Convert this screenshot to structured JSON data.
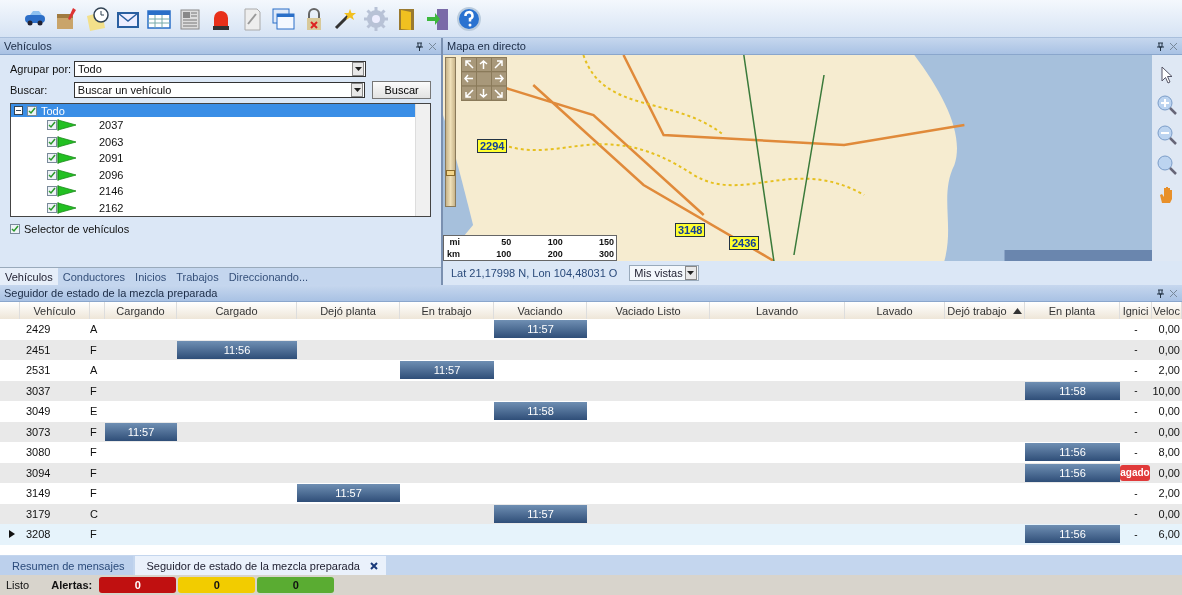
{
  "vehicles_panel": {
    "title": "Vehículos",
    "group_by": {
      "label": "Agrupar por:",
      "value": "Todo"
    },
    "search": {
      "label": "Buscar:",
      "value": "Buscar un vehículo",
      "button": "Buscar"
    },
    "tree": {
      "label": "Todo",
      "checked": true,
      "expanded": true,
      "selected": true,
      "children": [
        {
          "label": "2037",
          "checked": true
        },
        {
          "label": "2063",
          "checked": true
        },
        {
          "label": "2091",
          "checked": true
        },
        {
          "label": "2096",
          "checked": true
        },
        {
          "label": "2146",
          "checked": true
        },
        {
          "label": "2162",
          "checked": true
        }
      ]
    },
    "selector": {
      "label": "Selector de vehículos",
      "checked": true
    },
    "tabs": [
      {
        "label": "Vehículos",
        "selected": true
      },
      {
        "label": "Conductores",
        "selected": false
      },
      {
        "label": "Inicios",
        "selected": false
      },
      {
        "label": "Trabajos",
        "selected": false
      },
      {
        "label": "Direccionando...",
        "selected": false
      }
    ]
  },
  "map_panel": {
    "title": "Mapa en directo",
    "zoom": {
      "level": 0.2
    },
    "markers": [
      {
        "label": "2294"
      },
      {
        "label": "3148"
      },
      {
        "label": "2436"
      }
    ],
    "scale": {
      "mi_label": "mi",
      "km_label": "km",
      "mi_ticks": [
        "50",
        "100",
        "150"
      ],
      "km_ticks": [
        "100",
        "200",
        "300"
      ]
    },
    "coordinates": "Lat 21,17998 N, Lon 104,48031 O",
    "views_button": "Mis vistas"
  },
  "tracker_panel": {
    "title": "Seguidor de estado de la mezcla preparada",
    "columns": [
      {
        "label": "Vehículo",
        "sorted": false
      },
      {
        "sorted": false
      },
      {
        "label": "Cargando",
        "sorted": false
      },
      {
        "label": "Cargado",
        "sorted": false
      },
      {
        "label": "Dejó planta",
        "sorted": false
      },
      {
        "label": "En trabajo",
        "sorted": false
      },
      {
        "label": "Vaciando",
        "sorted": false
      },
      {
        "label": "Vaciado Listo",
        "sorted": false
      },
      {
        "label": "Lavando",
        "sorted": false
      },
      {
        "label": "Lavado",
        "sorted": false
      },
      {
        "label": "Dejó trabajo",
        "sorted": true
      },
      {
        "label": "En planta",
        "sorted": false
      },
      {
        "label": "Ignici",
        "sorted": false
      },
      {
        "label": "Veloc",
        "sorted": false
      }
    ],
    "rows": [
      {
        "vehicle": "2429",
        "column_2": "A",
        "stages": [
          {
            "filled": false
          },
          {
            "filled": false
          },
          {
            "filled": false
          },
          {
            "filled": false
          },
          {
            "filled": true,
            "time": "11:57"
          },
          {
            "filled": false
          },
          {
            "filled": false
          },
          {
            "filled": false
          },
          {
            "filled": false
          },
          {
            "filled": false
          }
        ],
        "ignition": "-",
        "ignition_alert": false,
        "speed": "0,00",
        "selected": false
      },
      {
        "vehicle": "2451",
        "column_2": "F",
        "stages": [
          {
            "filled": false
          },
          {
            "filled": true,
            "time": "11:56"
          },
          {
            "filled": false
          },
          {
            "filled": false
          },
          {
            "filled": false
          },
          {
            "filled": false
          },
          {
            "filled": false
          },
          {
            "filled": false
          },
          {
            "filled": false
          },
          {
            "filled": false
          }
        ],
        "ignition": "-",
        "ignition_alert": false,
        "speed": "0,00",
        "selected": false
      },
      {
        "vehicle": "2531",
        "column_2": "A",
        "stages": [
          {
            "filled": false
          },
          {
            "filled": false
          },
          {
            "filled": false
          },
          {
            "filled": true,
            "time": "11:57"
          },
          {
            "filled": false
          },
          {
            "filled": false
          },
          {
            "filled": false
          },
          {
            "filled": false
          },
          {
            "filled": false
          },
          {
            "filled": false
          }
        ],
        "ignition": "-",
        "ignition_alert": false,
        "speed": "2,00",
        "selected": false
      },
      {
        "vehicle": "3037",
        "column_2": "F",
        "stages": [
          {
            "filled": false
          },
          {
            "filled": false
          },
          {
            "filled": false
          },
          {
            "filled": false
          },
          {
            "filled": false
          },
          {
            "filled": false
          },
          {
            "filled": false
          },
          {
            "filled": false
          },
          {
            "filled": false
          },
          {
            "filled": true,
            "time": "11:58"
          }
        ],
        "ignition": "-",
        "ignition_alert": false,
        "speed": "10,00",
        "selected": false
      },
      {
        "vehicle": "3049",
        "column_2": "E",
        "stages": [
          {
            "filled": false
          },
          {
            "filled": false
          },
          {
            "filled": false
          },
          {
            "filled": false
          },
          {
            "filled": true,
            "time": "11:58"
          },
          {
            "filled": false
          },
          {
            "filled": false
          },
          {
            "filled": false
          },
          {
            "filled": false
          },
          {
            "filled": false
          }
        ],
        "ignition": "-",
        "ignition_alert": false,
        "speed": "0,00",
        "selected": false
      },
      {
        "vehicle": "3073",
        "column_2": "F",
        "stages": [
          {
            "filled": true,
            "time": "11:57"
          },
          {
            "filled": false
          },
          {
            "filled": false
          },
          {
            "filled": false
          },
          {
            "filled": false
          },
          {
            "filled": false
          },
          {
            "filled": false
          },
          {
            "filled": false
          },
          {
            "filled": false
          },
          {
            "filled": false
          }
        ],
        "ignition": "-",
        "ignition_alert": false,
        "speed": "0,00",
        "selected": false
      },
      {
        "vehicle": "3080",
        "column_2": "F",
        "stages": [
          {
            "filled": false
          },
          {
            "filled": false
          },
          {
            "filled": false
          },
          {
            "filled": false
          },
          {
            "filled": false
          },
          {
            "filled": false
          },
          {
            "filled": false
          },
          {
            "filled": false
          },
          {
            "filled": false
          },
          {
            "filled": true,
            "time": "11:56"
          }
        ],
        "ignition": "-",
        "ignition_alert": false,
        "speed": "8,00",
        "selected": false
      },
      {
        "vehicle": "3094",
        "column_2": "F",
        "stages": [
          {
            "filled": false
          },
          {
            "filled": false
          },
          {
            "filled": false
          },
          {
            "filled": false
          },
          {
            "filled": false
          },
          {
            "filled": false
          },
          {
            "filled": false
          },
          {
            "filled": false
          },
          {
            "filled": false
          },
          {
            "filled": true,
            "time": "11:56"
          }
        ],
        "ignition": "agado",
        "ignition_alert": true,
        "speed": "0,00",
        "selected": false
      },
      {
        "vehicle": "3149",
        "column_2": "F",
        "stages": [
          {
            "filled": false
          },
          {
            "filled": false
          },
          {
            "filled": true,
            "time": "11:57"
          },
          {
            "filled": false
          },
          {
            "filled": false
          },
          {
            "filled": false
          },
          {
            "filled": false
          },
          {
            "filled": false
          },
          {
            "filled": false
          },
          {
            "filled": false
          }
        ],
        "ignition": "-",
        "ignition_alert": false,
        "speed": "2,00",
        "selected": false
      },
      {
        "vehicle": "3179",
        "column_2": "C",
        "stages": [
          {
            "filled": false
          },
          {
            "filled": false
          },
          {
            "filled": false
          },
          {
            "filled": false
          },
          {
            "filled": true,
            "time": "11:57"
          },
          {
            "filled": false
          },
          {
            "filled": false
          },
          {
            "filled": false
          },
          {
            "filled": false
          },
          {
            "filled": false
          }
        ],
        "ignition": "-",
        "ignition_alert": false,
        "speed": "0,00",
        "selected": false
      },
      {
        "vehicle": "3208",
        "column_2": "F",
        "stages": [
          {
            "filled": false
          },
          {
            "filled": false
          },
          {
            "filled": false
          },
          {
            "filled": false
          },
          {
            "filled": false
          },
          {
            "filled": false
          },
          {
            "filled": false
          },
          {
            "filled": false
          },
          {
            "filled": false
          },
          {
            "filled": true,
            "time": "11:56"
          }
        ],
        "ignition": "-",
        "ignition_alert": false,
        "speed": "6,00",
        "selected": true
      }
    ]
  },
  "document_tabs": [
    {
      "label": "Resumen de mensajes",
      "selected": false,
      "closable": false
    },
    {
      "label": "Seguidor de estado de la mezcla preparada",
      "selected": true,
      "closable": true
    }
  ],
  "status_bar": {
    "text": "Listo",
    "alerts_label": "Alertas:",
    "alerts": [
      {
        "count": "0",
        "color": "#c01010"
      },
      {
        "count": "0",
        "color": "#f2cc00"
      },
      {
        "count": "0",
        "color": "#5aac32"
      }
    ]
  }
}
